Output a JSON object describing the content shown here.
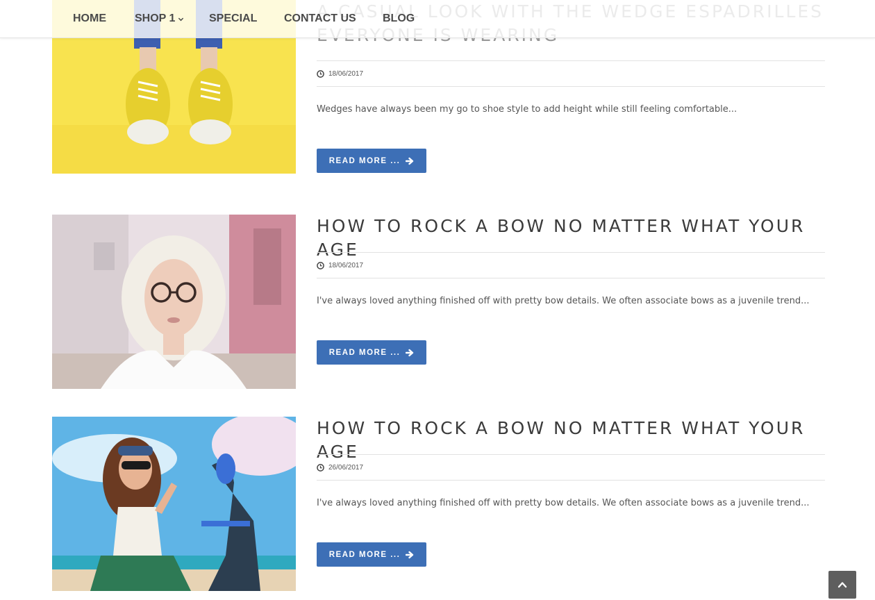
{
  "nav": {
    "items": [
      {
        "label": "HOME"
      },
      {
        "label": "SHOP 1"
      },
      {
        "label": "SPECIAL"
      },
      {
        "label": "CONTACT US"
      },
      {
        "label": "BLOG"
      }
    ]
  },
  "posts": [
    {
      "title": "A CASUAL LOOK WITH THE WEDGE ESPADRILLES EVERYONE IS WEARING",
      "date": "18/06/2017",
      "excerpt": "Wedges have always been my go to shoe style to add height while still feeling comfortable...",
      "button": "READ MORE ..."
    },
    {
      "title": "HOW TO ROCK A BOW NO MATTER WHAT YOUR AGE",
      "date": "18/06/2017",
      "excerpt": "I've always loved anything finished off with pretty bow details. We often associate bows as a juvenile trend...",
      "button": "READ MORE ..."
    },
    {
      "title": "HOW TO ROCK A BOW NO MATTER WHAT YOUR AGE",
      "date": "26/06/2017",
      "excerpt": "I've always loved anything finished off with pretty bow details. We often associate bows as a juvenile trend...",
      "button": "READ MORE ..."
    }
  ],
  "icons": {
    "nav_dropdown": "chevron-down-icon",
    "date": "clock-icon",
    "read_more": "arrow-right-icon",
    "back_to_top": "chevron-up-icon"
  },
  "colors": {
    "button": "#3d6fb6",
    "to_top": "#5e5e5e",
    "title": "#3b3b3b"
  }
}
